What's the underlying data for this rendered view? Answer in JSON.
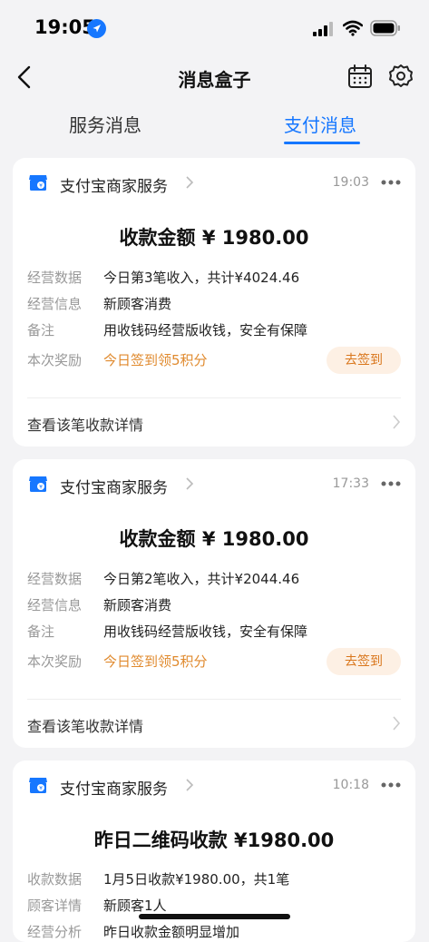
{
  "status": {
    "time": "19:05"
  },
  "nav": {
    "title": "消息盒子"
  },
  "tabs": [
    {
      "label": "服务消息",
      "active": false
    },
    {
      "label": "支付消息",
      "active": true
    }
  ],
  "colors": {
    "accent": "#1677ff",
    "reward": "#e08a2e"
  },
  "cards": [
    {
      "service": "支付宝商家服务",
      "time": "19:03",
      "amount_title": "收款金额 ¥ 1980.00",
      "rows": [
        {
          "label": "经营数据",
          "value": "今日第3笔收入，共计¥4024.46"
        },
        {
          "label": "经营信息",
          "value": "新顾客消费"
        },
        {
          "label": "备注",
          "value": "用收钱码经营版收钱，安全有保障"
        },
        {
          "label": "本次奖励",
          "value": "今日签到领5积分"
        }
      ],
      "action_label": "去签到",
      "detail_label": "查看该笔收款详情"
    },
    {
      "service": "支付宝商家服务",
      "time": "17:33",
      "amount_title": "收款金额 ¥ 1980.00",
      "rows": [
        {
          "label": "经营数据",
          "value": "今日第2笔收入，共计¥2044.46"
        },
        {
          "label": "经营信息",
          "value": "新顾客消费"
        },
        {
          "label": "备注",
          "value": "用收钱码经营版收钱，安全有保障"
        },
        {
          "label": "本次奖励",
          "value": "今日签到领5积分"
        }
      ],
      "action_label": "去签到",
      "detail_label": "查看该笔收款详情"
    },
    {
      "service": "支付宝商家服务",
      "time": "10:18",
      "amount_title": "昨日二维码收款 ¥1980.00",
      "rows": [
        {
          "label": "收款数据",
          "value": "1月5日收款¥1980.00，共1笔"
        },
        {
          "label": "顾客详情",
          "value": "新顾客1人"
        },
        {
          "label": "经营分析",
          "value": "昨日收款金额明显增加"
        }
      ]
    }
  ]
}
